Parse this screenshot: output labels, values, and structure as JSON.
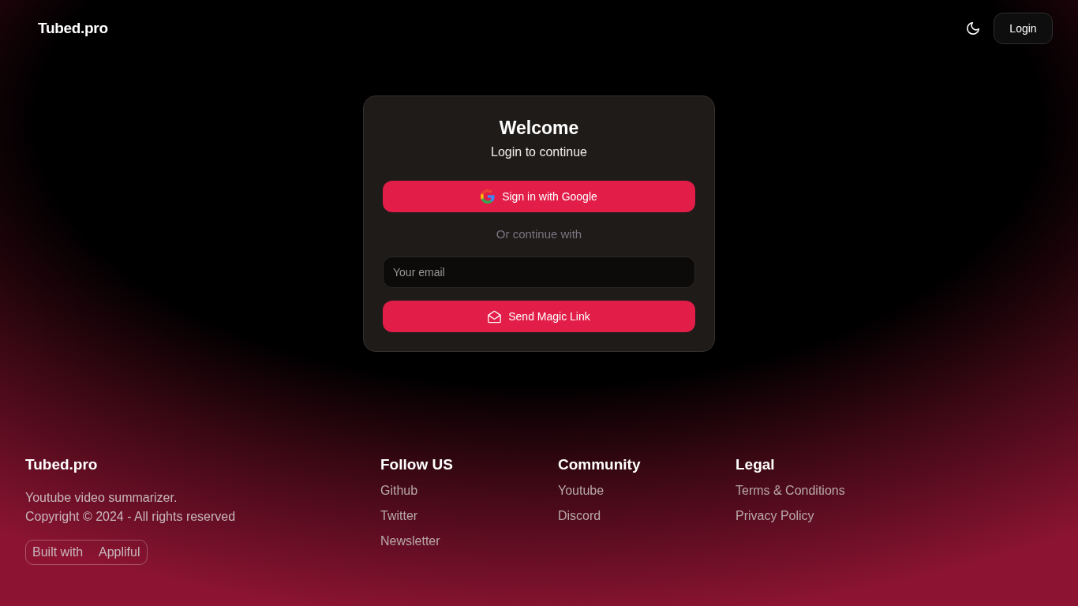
{
  "header": {
    "logo": "Tubed.pro",
    "login_button": "Login"
  },
  "login_card": {
    "title": "Welcome",
    "subtitle": "Login to continue",
    "google_button": "Sign in with Google",
    "divider_text": "Or continue with",
    "email_field": {
      "placeholder": "Your email"
    },
    "magic_link_button": "Send Magic Link"
  },
  "footer": {
    "brand": "Tubed.pro",
    "description": [
      "Youtube video summarizer.",
      "Copyright © 2024 - All rights reserved"
    ],
    "badge": {
      "label": "Built with",
      "brand": "Appliful"
    },
    "columns": [
      {
        "title": "Follow US",
        "links": [
          "Github",
          "Twitter",
          "Newsletter"
        ]
      },
      {
        "title": "Community",
        "links": [
          "Youtube",
          "Discord"
        ]
      },
      {
        "title": "Legal",
        "links": [
          "Terms & Conditions",
          "Privacy Policy"
        ]
      }
    ]
  }
}
